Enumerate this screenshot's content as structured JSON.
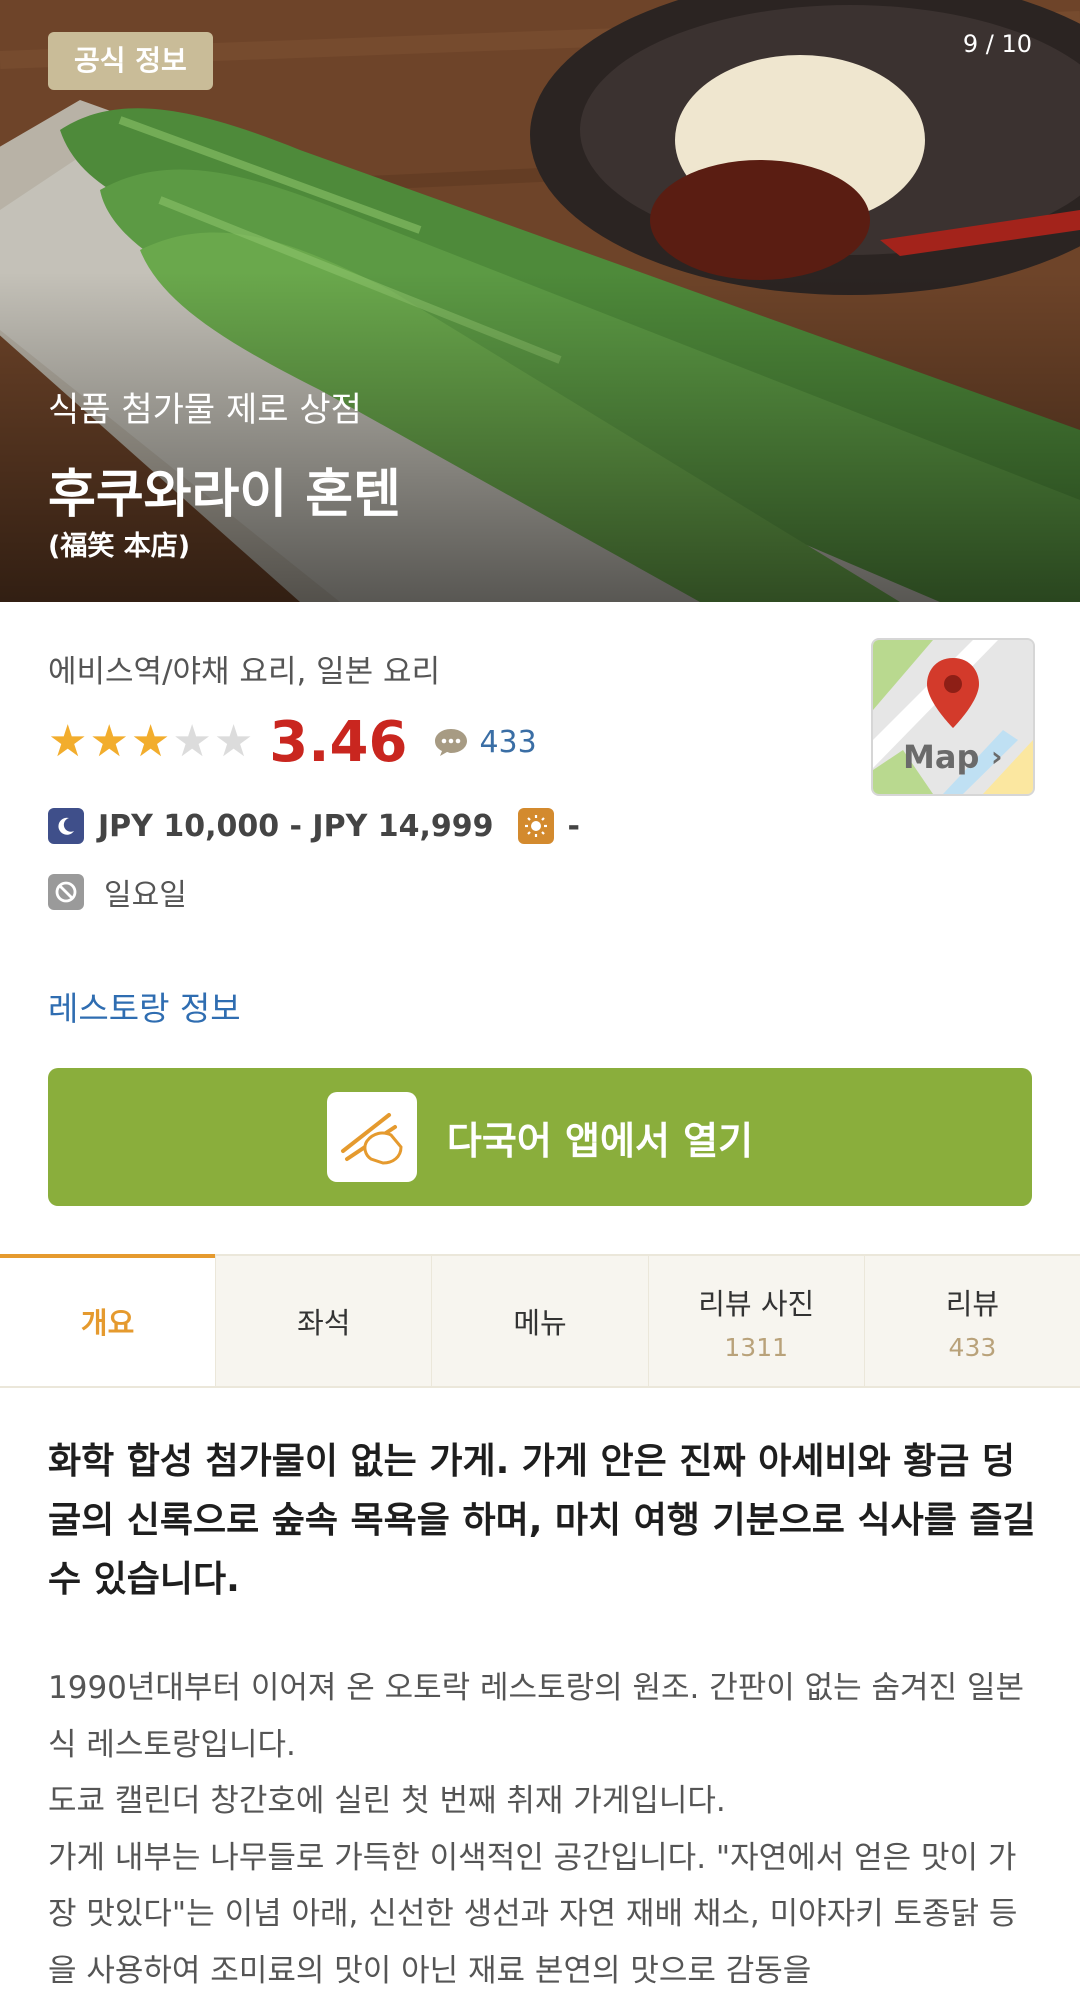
{
  "hero": {
    "badge": "공식 정보",
    "counter": "9 / 10",
    "subtitle": "식품 첨가물 제로 상점",
    "title": "후쿠와라이 혼텐",
    "original_name": "(福笑 本店)"
  },
  "info": {
    "category": "에비스역/야채 요리, 일본 요리",
    "rating": {
      "stars_filled": 3,
      "stars_total": 5,
      "score": "3.46",
      "review_count": "433"
    },
    "map_label": "Map",
    "dinner_price": "JPY 10,000 - JPY 14,999",
    "lunch_price": "-",
    "closed_day": "일요일",
    "restaurant_info_link": "레스토랑 정보",
    "open_app_button": "다국어 앱에서 열기"
  },
  "tabs": [
    {
      "label": "개요",
      "count": ""
    },
    {
      "label": "좌석",
      "count": ""
    },
    {
      "label": "메뉴",
      "count": ""
    },
    {
      "label": "리뷰 사진",
      "count": "1311"
    },
    {
      "label": "리뷰",
      "count": "433"
    }
  ],
  "article": {
    "headline": "화학 합성 첨가물이 없는 가게. 가게 안은 진짜 아세비와 황금 덩굴의 신록으로 숲속 목욕을 하며, 마치 여행 기분으로 식사를 즐길 수 있습니다.",
    "paragraphs": [
      "1990년대부터 이어져 온 오토락 레스토랑의 원조. 간판이 없는 숨겨진 일본식 레스토랑입니다.",
      "도쿄 캘린더 창간호에 실린 첫 번째 취재 가게입니다.",
      "가게 내부는 나무들로 가득한 이색적인 공간입니다. \"자연에서 얻은 맛이 가장 맛있다\"는 이념 아래, 신선한 생선과 자연 재배 채소, 미야자키 토종닭 등을 사용하여 조미료의 맛이 아닌 재료 본연의 맛으로 감동을"
    ]
  },
  "colors": {
    "accent_orange": "#e59a2e",
    "button_green": "#8aae3c",
    "score_red": "#c9261f",
    "link_blue": "#2f6db1"
  }
}
